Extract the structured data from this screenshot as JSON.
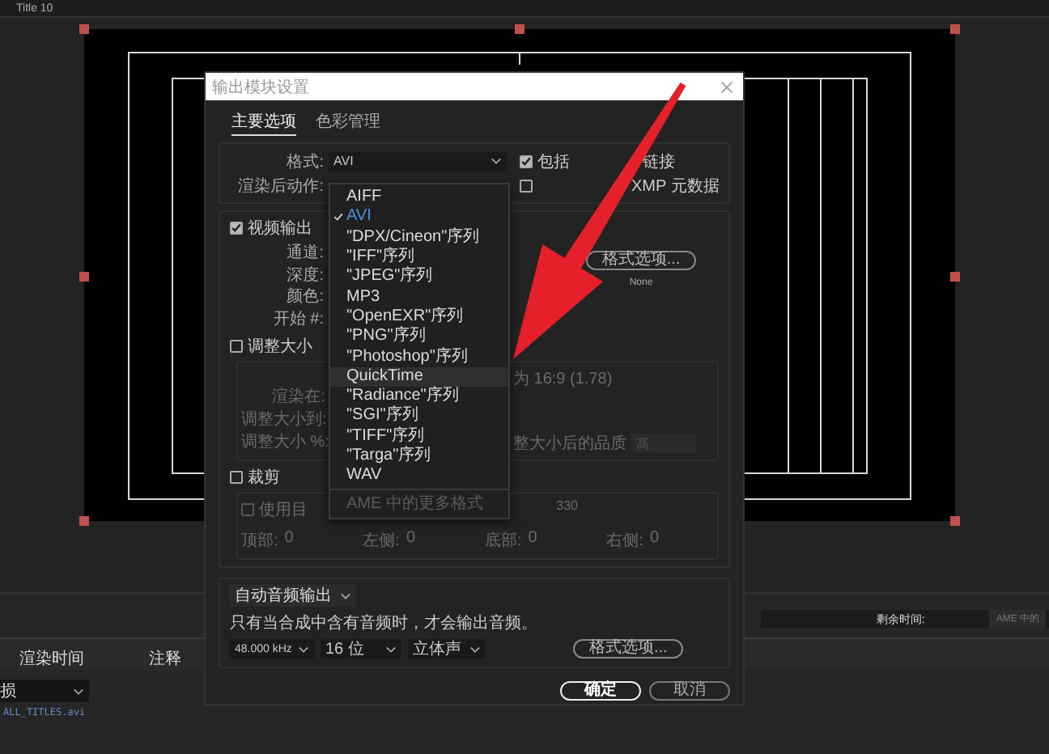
{
  "panel": {
    "title": "Title 10"
  },
  "dialog": {
    "title": "输出模块设置",
    "tabs": [
      {
        "label": "主要选项",
        "selected": true
      },
      {
        "label": "色彩管理",
        "selected": false
      }
    ],
    "format": {
      "label": "格式:",
      "value": "AVI",
      "post_render_label": "渲染后动作:"
    },
    "options": [
      {
        "parts": [
          "包括",
          "链接"
        ],
        "checked": true
      },
      {
        "parts": [
          "XMP 元数据"
        ],
        "checked": false
      }
    ],
    "format_menu": {
      "items": [
        {
          "label": "AIFF",
          "selected": false,
          "highlighted": false
        },
        {
          "label": "AVI",
          "selected": true,
          "highlighted": false
        },
        {
          "label": "\"DPX/Cineon\"序列",
          "selected": false,
          "highlighted": false
        },
        {
          "label": "\"IFF\"序列",
          "selected": false,
          "highlighted": false
        },
        {
          "label": "\"JPEG\"序列",
          "selected": false,
          "highlighted": false
        },
        {
          "label": "MP3",
          "selected": false,
          "highlighted": false
        },
        {
          "label": "\"OpenEXR\"序列",
          "selected": false,
          "highlighted": false
        },
        {
          "label": "\"PNG\"序列",
          "selected": false,
          "highlighted": false
        },
        {
          "label": "\"Photoshop\"序列",
          "selected": false,
          "highlighted": false
        },
        {
          "label": "QuickTime",
          "selected": false,
          "highlighted": true
        },
        {
          "label": "\"Radiance\"序列",
          "selected": false,
          "highlighted": false
        },
        {
          "label": "\"SGI\"序列",
          "selected": false,
          "highlighted": false
        },
        {
          "label": "\"TIFF\"序列",
          "selected": false,
          "highlighted": false
        },
        {
          "label": "\"Targa\"序列",
          "selected": false,
          "highlighted": false
        },
        {
          "label": "WAV",
          "selected": false,
          "highlighted": false
        }
      ],
      "more": {
        "label": "AME 中的更多格式",
        "disabled": true
      }
    },
    "video": {
      "label": "视频输出",
      "checked": true,
      "fields": [
        "通道:",
        "深度:",
        "颜色:",
        "开始 #:"
      ],
      "format_options": "格式选项...",
      "codec": "None"
    },
    "resize": {
      "label": "调整大小",
      "checked": false,
      "fields": [
        "渲染在:",
        "调整大小到:",
        "调整大小 %:"
      ],
      "aspect": "为 16:9 (1.78)",
      "quality_label": "整大小后的品质",
      "quality": "高"
    },
    "crop": {
      "label": "裁剪",
      "checked": false,
      "use_region": {
        "label": "使用目",
        "checked": false
      },
      "size": "330",
      "edges": [
        {
          "label": "顶部:",
          "value": "0"
        },
        {
          "label": "左侧:",
          "value": "0"
        },
        {
          "label": "底部:",
          "value": "0"
        },
        {
          "label": "右侧:",
          "value": "0"
        }
      ]
    },
    "audio": {
      "mode": "自动音频输出",
      "note": "只有当合成中含有音频时，才会输出音频。",
      "rate": "48.000 kHz",
      "depth": "16 位",
      "channels": "立体声",
      "format_options": "格式选项..."
    },
    "buttons": [
      {
        "label": "确定",
        "kind": "primary"
      },
      {
        "label": "取消",
        "kind": "secondary"
      }
    ]
  },
  "render_queue": {
    "remaining_label": "剩余时间:",
    "ame": "AME 中的",
    "columns": [
      "渲染时间",
      "注释"
    ],
    "output_module": "损",
    "output_file": "ALL_TITLES.avi"
  }
}
